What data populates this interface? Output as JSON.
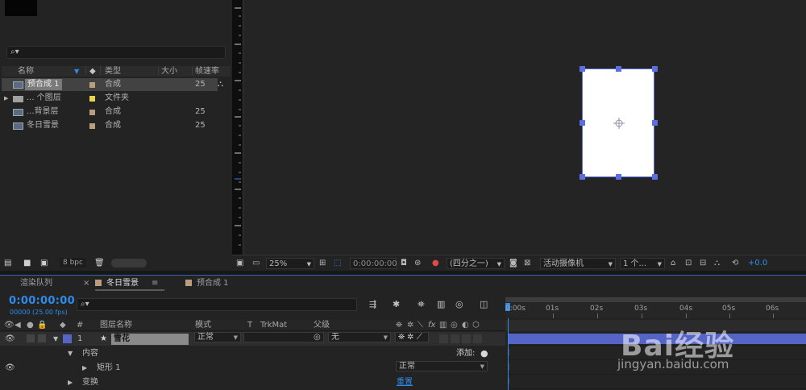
{
  "project": {
    "search_glyph": "⌕▾",
    "columns": {
      "name": "名称",
      "type": "类型",
      "size": "大小",
      "fps": "帧速率"
    },
    "items": [
      {
        "name": "预合成 1",
        "type": "合成",
        "fps": "25",
        "selected": true,
        "label_color": "#b89d7e",
        "icon": "composition-icon"
      },
      {
        "name": "... 个图层",
        "type": "文件夹",
        "fps": "",
        "label_color": "#e8d44d",
        "icon": "folder-icon"
      },
      {
        "name": "...背景层",
        "type": "合成",
        "fps": "25",
        "label_color": "#b89d7e",
        "icon": "composition-icon"
      },
      {
        "name": "冬日雪景",
        "type": "合成",
        "fps": "25",
        "label_color": "#b89d7e",
        "icon": "composition-icon"
      }
    ],
    "footer": {
      "bpc": "8 bpc"
    }
  },
  "viewer": {
    "zoom": "25%",
    "timecode": "0:00:00:00",
    "resolution": "(四分之一)",
    "camera": "活动摄像机",
    "views": "1 个...",
    "exposure": "+0.0"
  },
  "timeline": {
    "tabs": {
      "render_queue": "渲染队列",
      "close": "×",
      "active": "冬日雪景",
      "menu": "≡",
      "other": "预合成 1"
    },
    "timecode": "0:00:00:00",
    "fps_info": "00000 (25.00 fps)",
    "search_glyph": "⌕▾",
    "time_ticks": [
      "0:00s",
      "01s",
      "02s",
      "03s",
      "04s",
      "05s",
      "06s"
    ],
    "columns": {
      "hash": "#",
      "layer_name": "图层名称",
      "mode": "模式",
      "t": "T",
      "trkmat": "TrkMat",
      "parent": "父级",
      "fx": "fx"
    },
    "layer": {
      "number": "1",
      "star": "★",
      "name": "雪花",
      "mode": "正常",
      "parent": "无"
    },
    "contents": {
      "label": "内容",
      "add": "添加:"
    },
    "rect": {
      "label": "矩形 1",
      "mode": "正常"
    },
    "transform": {
      "label": "变换",
      "reset": "重置"
    },
    "ibeam": "I"
  },
  "watermark": {
    "brand": "Bai经验",
    "url": "jingyan.baidu.com"
  },
  "colors": {
    "accent": "#2d8ceb",
    "layer_bar": "#5665c5",
    "comp_label": "#b89d7e",
    "folder_label": "#e8d44d"
  }
}
